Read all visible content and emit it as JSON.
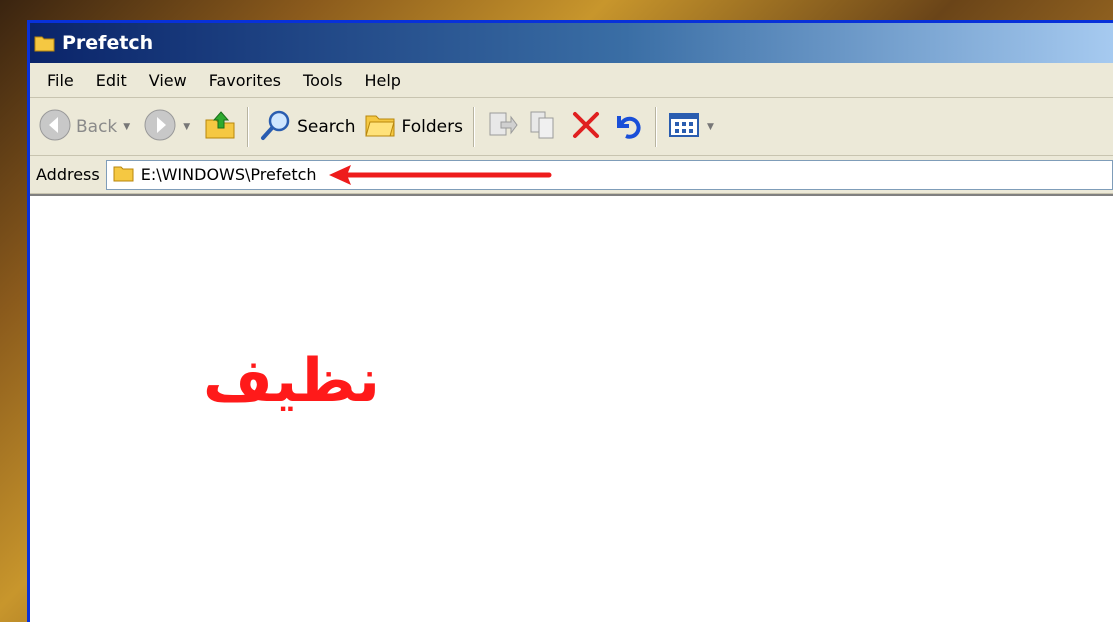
{
  "window": {
    "title": "Prefetch",
    "icon": "folder-icon"
  },
  "menu": [
    "File",
    "Edit",
    "View",
    "Favorites",
    "Tools",
    "Help"
  ],
  "toolbar": {
    "back_label": "Back",
    "search_label": "Search",
    "folders_label": "Folders",
    "icons": [
      "back-icon",
      "forward-icon",
      "up-folder-icon",
      "search-icon",
      "folders-icon",
      "move-to-icon",
      "copy-to-icon",
      "delete-icon",
      "undo-icon",
      "views-icon"
    ]
  },
  "address": {
    "label": "Address",
    "value": "E:\\WINDOWS\\Prefetch"
  },
  "annotation": {
    "text": "نظيف",
    "color": "#ff1a1a"
  },
  "colors": {
    "title_start": "#0a246a",
    "title_end": "#a6caf0",
    "chrome": "#ece9d8"
  }
}
